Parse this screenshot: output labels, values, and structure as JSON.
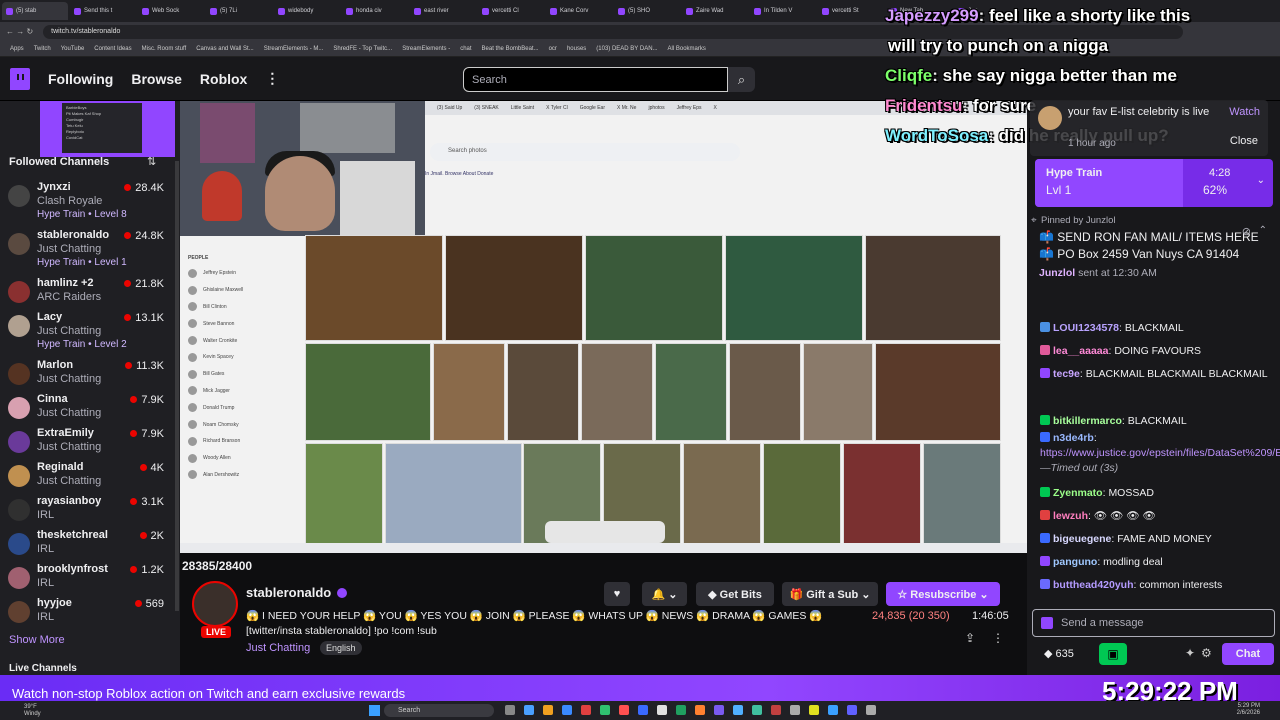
{
  "browser": {
    "tabs": [
      "(5) stab",
      "Send this t",
      "Web Sock",
      "(5) 7Li",
      "widebody",
      "honda civ",
      "east river",
      "vercetti Cl",
      "Kane Corv",
      "(5) SHO",
      "Zaire Wad",
      "In Tilden V",
      "vercetti St",
      "New Tab",
      "Jap"
    ],
    "url": "twitch.tv/stableronaldo",
    "action_required": "Action required",
    "bookmarks": [
      "Apps",
      "Twitch",
      "YouTube",
      "Content Ideas",
      "Misc. Room stuff",
      "Canvas and Wall St...",
      "StreamElements - M...",
      "ShredFE - Top Twitc...",
      "StreamElements -",
      "chat",
      "Beat the BombBeat...",
      "ocr",
      "houses",
      "(103) DEAD BY DAN...",
      "All Bookmarks"
    ]
  },
  "nav": {
    "following": "Following",
    "browse": "Browse",
    "roblox": "Roblox",
    "more": "⋮",
    "search_placeholder": "Search"
  },
  "sidebar": {
    "preview_lines": [
      "BarbieBoys",
      "Pit Makes Kaf Shop",
      "Cumbugir",
      "Tetu Kelu",
      "Replyboto",
      "CovidCat"
    ],
    "followed_title": "Followed Channels",
    "channels": [
      {
        "name": "Jynxzi",
        "game": "Clash Royale",
        "viewers": "28.4K",
        "hype": "Hype Train • Level 8",
        "color": "#444"
      },
      {
        "name": "stableronaldo",
        "game": "Just Chatting",
        "viewers": "24.8K",
        "hype": "Hype Train • Level 1",
        "color": "#5a4a40"
      },
      {
        "name": "hamlinz +2",
        "game": "ARC Raiders",
        "viewers": "21.8K",
        "hype": "",
        "color": "#8a3030"
      },
      {
        "name": "Lacy",
        "game": "Just Chatting",
        "viewers": "13.1K",
        "hype": "Hype Train • Level 2",
        "color": "#b0a090"
      },
      {
        "name": "Marlon",
        "game": "Just Chatting",
        "viewers": "11.3K",
        "hype": "",
        "color": "#553322"
      },
      {
        "name": "Cinna",
        "game": "Just Chatting",
        "viewers": "7.9K",
        "hype": "",
        "color": "#d8a0b0"
      },
      {
        "name": "ExtraEmily",
        "game": "Just Chatting",
        "viewers": "7.9K",
        "hype": "",
        "color": "#6a3a9a"
      },
      {
        "name": "Reginald",
        "game": "Just Chatting",
        "viewers": "4K",
        "hype": "",
        "color": "#c09050"
      },
      {
        "name": "rayasianboy",
        "game": "IRL",
        "viewers": "3.1K",
        "hype": "",
        "color": "#303030"
      },
      {
        "name": "thesketchreal",
        "game": "IRL",
        "viewers": "2K",
        "hype": "",
        "color": "#2a4a8a"
      },
      {
        "name": "brooklynfrost",
        "game": "IRL",
        "viewers": "1.2K",
        "hype": "",
        "color": "#a06070"
      },
      {
        "name": "hyyjoe",
        "game": "IRL",
        "viewers": "569",
        "hype": "",
        "color": "#604030"
      }
    ],
    "show_more": "Show More",
    "live_channels": "Live Channels"
  },
  "video": {
    "inner_tabs": [
      "(3) Said Up",
      "(3) SNEAK",
      "Little Saint",
      "X Tyler Cl",
      "Google Ear",
      "X Mr. Ne",
      "jphotos",
      "Jeffrey Eps",
      "X"
    ],
    "search_placeholder": "Search photos",
    "jemini": "Jemini",
    "inner_links": "In Jmail. Browse  About  Donate",
    "only": "only",
    "nsfw": "NSFW",
    "count_badge": "164",
    "people_title": "PEOPLE",
    "people": [
      "Jeffrey Epstein",
      "Ghislaine Maxwell",
      "Bill Clinton",
      "Steve Bannon",
      "Walter Cronkite",
      "Kevin Spacey",
      "Bill Gates",
      "Mick Jagger",
      "Donald Trump",
      "Noam Chomsky",
      "Richard Branson",
      "Woody Allen",
      "Alan Dershowitz"
    ],
    "progress_label": "28385/28400",
    "progress": 0.9995,
    "taskbar_search": "Search",
    "taskbar_time": "2:01:29"
  },
  "stream": {
    "live": "LIVE",
    "name": "stableronaldo",
    "title": "😱 I NEED YOUR HELP 😱 YOU 😱 YES YOU 😱 JOIN 😱 PLEASE 😱 WHATS UP 😱 NEWS 😱 DRAMA 😱 GAMES 😱 [twitter/insta stableronaldo] !po !com !sub",
    "category": "Just Chatting",
    "tag": "English",
    "viewers": "24,835 (20 350)",
    "uptime": "1:46:05",
    "heart": "♥",
    "bell": "🔔 ⌄",
    "get_bits": "◆ Get Bits",
    "gift_sub": "🎁 Gift a Sub ⌄",
    "resubscribe": "☆ Resubscribe ⌄",
    "share": "⇪",
    "more": "⋮"
  },
  "overlay": {
    "lines": [
      {
        "user": "Japezzy299",
        "text": "feel like a shorty like this",
        "color": "#d59cff"
      },
      {
        "user": "",
        "text": "will try to punch on a nigga",
        "color": "#ffffff"
      },
      {
        "user": "Cliqfe",
        "text": "she say nigga better than me",
        "color": "#7cff6a"
      },
      {
        "user": "Fridentsu",
        "text": "for sure",
        "color": "#ff8ad0"
      },
      {
        "user": "WordToSosa",
        "text": "did he really pull up?",
        "color": "#7ef0ff"
      }
    ]
  },
  "popup": {
    "text": "your fav E-list celebrity is live",
    "watch": "Watch",
    "time": "1 hour ago",
    "close": "Close"
  },
  "chat": {
    "hype_title": "Hype Train",
    "hype_level": "Lvl 1",
    "hype_time": "4:28",
    "hype_pct": "62%",
    "hype_progress": 0.62,
    "pinned_by": "Pinned by Junzlol",
    "pinned_text": "📫 SEND RON FAN MAIL/ ITEMS HERE 📫 PO Box 2459 Van Nuys CA 91404",
    "pinned_user": "Junzlol",
    "pinned_time": "sent at 12:30 AM",
    "messages": [
      {
        "user": "LOUI1234578",
        "text": "BLACKMAIL",
        "color": "#b9a3ff"
      },
      {
        "user": "lea__aaaaa",
        "text": "DOING FAVOURS",
        "color": "#ff8ad8"
      },
      {
        "user": "tec9e",
        "text": "BLACKMAIL BLACKMAIL BLACKMAIL",
        "color": "#c8a5ff"
      },
      {
        "user": "bitkillermarco",
        "text": "BLACKMAIL",
        "color": "#a8ff9c"
      },
      {
        "user": "n3de4rb",
        "text": "",
        "color": "#9ab9ff"
      },
      {
        "user": "Zyenmato",
        "text": "MOSSAD",
        "color": "#9cff8a"
      },
      {
        "user": "lewzuh",
        "text": "👁 👁 👁 👁",
        "color": "#ff7fbf"
      },
      {
        "user": "bigeuegene",
        "text": "FAME AND MONEY",
        "color": "#d8d8ff"
      },
      {
        "user": "panguno",
        "text": "modling deal",
        "color": "#a0c8ff"
      },
      {
        "user": "butthead420yuh",
        "text": "common interests",
        "color": "#b49bff"
      }
    ],
    "link": "https://www.justice.gov/epstein/files/DataSet%209/EFTA00147661.pdf",
    "timed_out": "—Timed out (3s)",
    "input_placeholder": "Send a message",
    "points": "635",
    "chat_button": "Chat"
  },
  "banner": {
    "text": "Watch non-stop Roblox action on Twitch and earn exclusive rewards",
    "clock": "5:29:22 PM"
  },
  "taskbar": {
    "weather_temp": "39°F",
    "weather_desc": "Windy",
    "search": "Search",
    "time": "5:29 PM",
    "date": "2/6/2026"
  },
  "colors": {
    "twitch_purple": "#9146ff",
    "live_red": "#eb0400",
    "chat_bg": "#18181b"
  }
}
